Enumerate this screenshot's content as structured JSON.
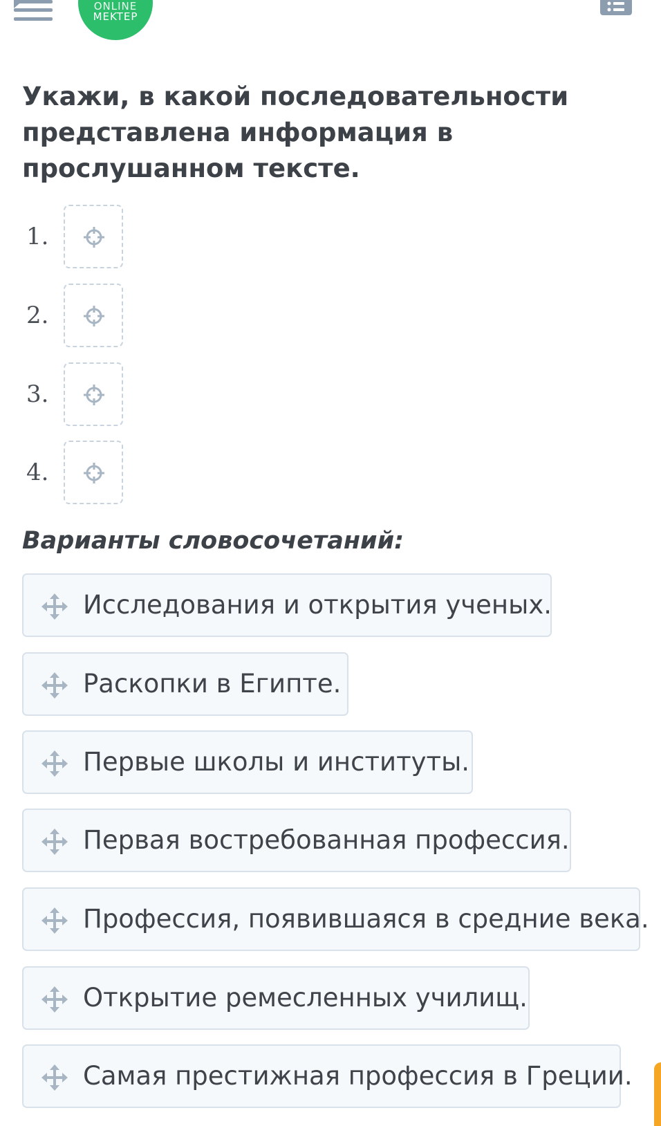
{
  "header": {
    "logo_line1": "ONLINE",
    "logo_line2": "MEKTEP",
    "menu_icon": "menu-collapse-icon",
    "list_icon": "list-icon"
  },
  "question": {
    "text": "Укажи, в какой последовательности представлена информация в прослушанном тексте."
  },
  "slots": [
    {
      "number": "1."
    },
    {
      "number": "2."
    },
    {
      "number": "3."
    },
    {
      "number": "4."
    }
  ],
  "variants": {
    "title": "Варианты словосочетаний:",
    "options": [
      {
        "label": "Исследования и открытия ученых."
      },
      {
        "label": "Раскопки в Египте."
      },
      {
        "label": "Первые школы и институты."
      },
      {
        "label": "Первая востребованная профессия."
      },
      {
        "label": "Профессия, появившаяся в средние века."
      },
      {
        "label": "Открытие ремесленных училищ."
      },
      {
        "label": "Самая престижная профессия в Греции."
      }
    ]
  },
  "colors": {
    "brand_green": "#2dbe6c",
    "icon_gray": "#8d9db0",
    "card_bg": "#f5f9fc",
    "card_border": "#d9e1ea",
    "slot_border": "#c9d3de",
    "accent_orange": "#f5a623"
  }
}
